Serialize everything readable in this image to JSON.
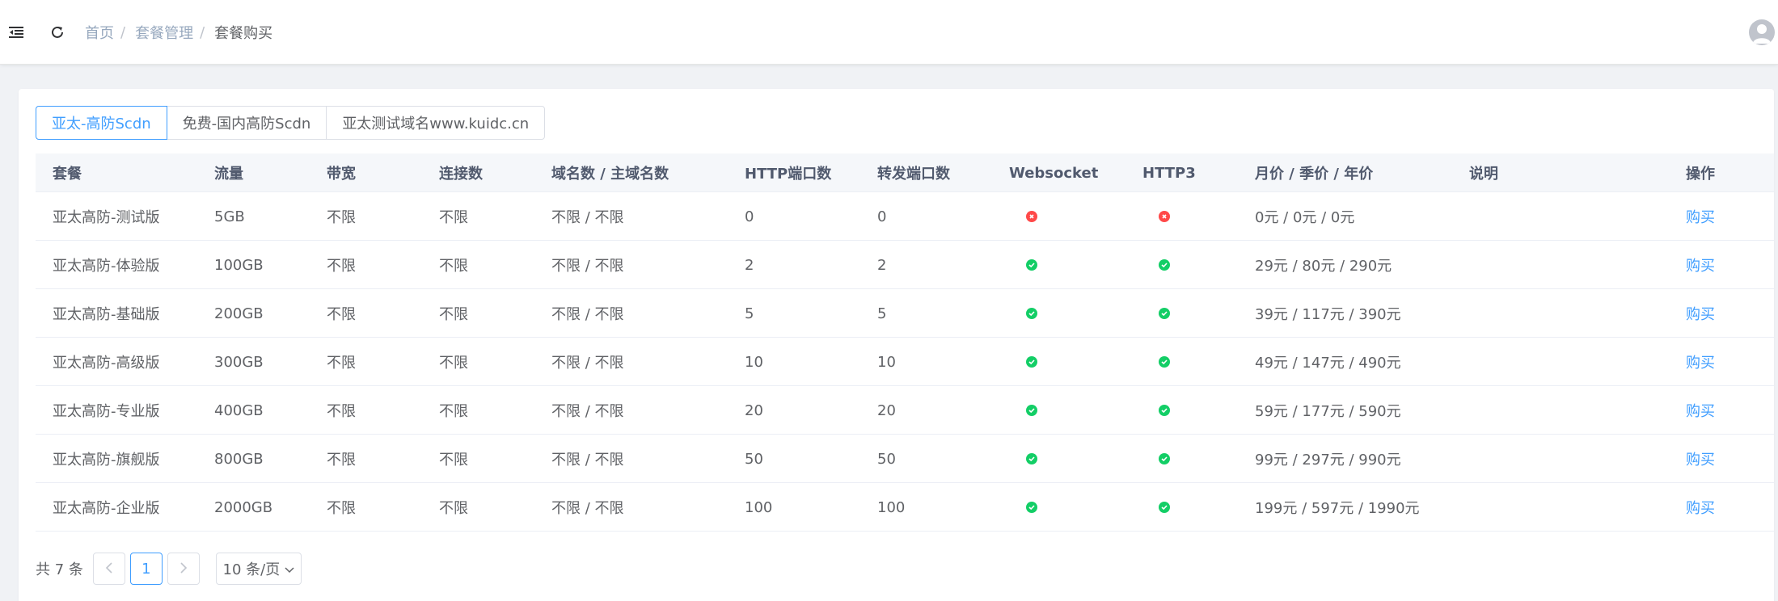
{
  "breadcrumb": [
    "首页",
    "套餐管理",
    "套餐购买"
  ],
  "tabs": [
    {
      "label": "亚太-高防Scdn",
      "active": true
    },
    {
      "label": "免费-国内高防Scdn",
      "active": false
    },
    {
      "label": "亚太测试域名www.kuidc.cn",
      "active": false
    }
  ],
  "table": {
    "headers": [
      "套餐",
      "流量",
      "带宽",
      "连接数",
      "域名数 / 主域名数",
      "HTTP端口数",
      "转发端口数",
      "Websocket",
      "HTTP3",
      "月价 / 季价 / 年价",
      "说明",
      "操作"
    ],
    "rows": [
      {
        "name": "亚太高防-测试版",
        "traffic": "5GB",
        "bandwidth": "不限",
        "connections": "不限",
        "domains": "不限 / 不限",
        "http_ports": "0",
        "forward_ports": "0",
        "websocket": false,
        "http3": false,
        "price": "0元 / 0元 / 0元",
        "desc": "",
        "action": "购买"
      },
      {
        "name": "亚太高防-体验版",
        "traffic": "100GB",
        "bandwidth": "不限",
        "connections": "不限",
        "domains": "不限 / 不限",
        "http_ports": "2",
        "forward_ports": "2",
        "websocket": true,
        "http3": true,
        "price": "29元 / 80元 / 290元",
        "desc": "",
        "action": "购买"
      },
      {
        "name": "亚太高防-基础版",
        "traffic": "200GB",
        "bandwidth": "不限",
        "connections": "不限",
        "domains": "不限 / 不限",
        "http_ports": "5",
        "forward_ports": "5",
        "websocket": true,
        "http3": true,
        "price": "39元 / 117元 / 390元",
        "desc": "",
        "action": "购买"
      },
      {
        "name": "亚太高防-高级版",
        "traffic": "300GB",
        "bandwidth": "不限",
        "connections": "不限",
        "domains": "不限 / 不限",
        "http_ports": "10",
        "forward_ports": "10",
        "websocket": true,
        "http3": true,
        "price": "49元 / 147元 / 490元",
        "desc": "",
        "action": "购买"
      },
      {
        "name": "亚太高防-专业版",
        "traffic": "400GB",
        "bandwidth": "不限",
        "connections": "不限",
        "domains": "不限 / 不限",
        "http_ports": "20",
        "forward_ports": "20",
        "websocket": true,
        "http3": true,
        "price": "59元 / 177元 / 590元",
        "desc": "",
        "action": "购买"
      },
      {
        "name": "亚太高防-旗舰版",
        "traffic": "800GB",
        "bandwidth": "不限",
        "connections": "不限",
        "domains": "不限 / 不限",
        "http_ports": "50",
        "forward_ports": "50",
        "websocket": true,
        "http3": true,
        "price": "99元 / 297元 / 990元",
        "desc": "",
        "action": "购买"
      },
      {
        "name": "亚太高防-企业版",
        "traffic": "2000GB",
        "bandwidth": "不限",
        "connections": "不限",
        "domains": "不限 / 不限",
        "http_ports": "100",
        "forward_ports": "100",
        "websocket": true,
        "http3": true,
        "price": "199元 / 597元 / 1990元",
        "desc": "",
        "action": "购买"
      }
    ]
  },
  "pagination": {
    "total": "共 7 条",
    "current_page": "1",
    "page_size": "10 条/页"
  },
  "colors": {
    "accent": "#409eff",
    "ok": "#13ce66",
    "no": "#ff4949"
  },
  "icons": {
    "hamburger": "menu-fold-icon",
    "refresh": "refresh-icon",
    "avatar": "user-avatar-icon",
    "ok": "check-circle-icon",
    "no": "close-circle-icon"
  }
}
